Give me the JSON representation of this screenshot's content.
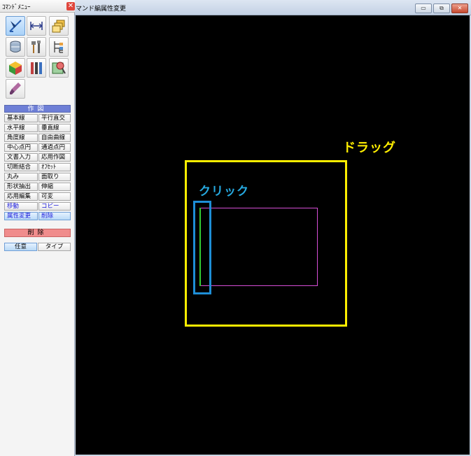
{
  "panel": {
    "title": "ｺﾏﾝﾄﾞﾒﾆｭｰ",
    "close": "✕"
  },
  "tools": [
    {
      "icon": "select-draw-tool-icon"
    },
    {
      "icon": "dimension-tool-icon"
    },
    {
      "icon": "layers-tool-icon"
    },
    {
      "icon": "drum-tool-icon"
    },
    {
      "icon": "hammer-tool-icon"
    },
    {
      "icon": "tree-structure-tool-icon"
    },
    {
      "icon": "color-cube-tool-icon"
    },
    {
      "icon": "tools-set-icon"
    },
    {
      "icon": "globe-map-tool-icon"
    },
    {
      "icon": "brush-tool-icon"
    }
  ],
  "sections": {
    "draw": "作図",
    "delete": "削除"
  },
  "commands": [
    [
      "基本線",
      "平行直交"
    ],
    [
      "水平線",
      "垂直線"
    ],
    [
      "角度線",
      "自由曲線"
    ],
    [
      "中心点円",
      "通過点円"
    ],
    [
      "文書入力",
      "応用作図"
    ],
    [
      "切断結合",
      "ｵﾌｾｯﾄ"
    ],
    [
      "丸み",
      "面取り"
    ],
    [
      "形状抽出",
      "伸縮"
    ],
    [
      "応用編集",
      "可変"
    ],
    [
      "移動",
      "コピー"
    ],
    [
      "属性変更",
      "削除"
    ]
  ],
  "modes": [
    "任意",
    "タイプ"
  ],
  "window": {
    "title": "マンド編属性変更",
    "minimize": "▭",
    "maximize": "⧉",
    "close": "✕"
  },
  "canvas": {
    "drag_label": "ドラッグ",
    "click_label": "クリック",
    "colors": {
      "drag": "#ffee00",
      "click": "#1e8ed6",
      "shape": "#d64fd6",
      "selected_line": "#33cc33"
    }
  }
}
